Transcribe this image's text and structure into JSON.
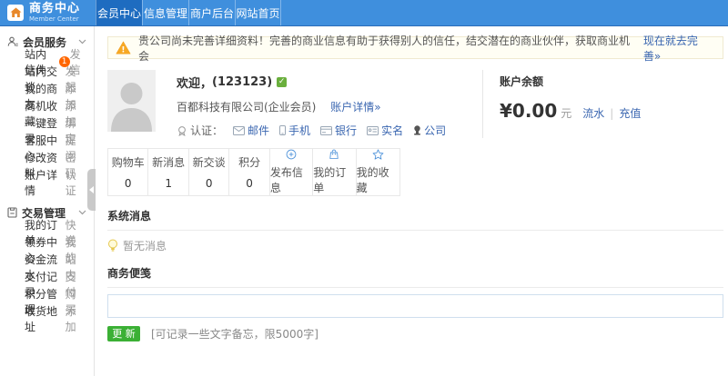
{
  "header": {
    "logo": {
      "title": "商务中心",
      "subtitle": "Member Center"
    },
    "tabs": [
      {
        "label": "会员中心",
        "active": true
      },
      {
        "label": "信息管理",
        "active": false
      },
      {
        "label": "商户后台",
        "active": false
      },
      {
        "label": "网站首页",
        "active": false
      }
    ]
  },
  "sidebar": {
    "sections": [
      {
        "title": "会员服务",
        "items": [
          {
            "label": "站内信件",
            "badge": "1",
            "action": "发信"
          },
          {
            "label": "站内交谈",
            "action": "发起"
          },
          {
            "label": "我的商友",
            "action": "添加"
          },
          {
            "label": "商机收藏",
            "action": "添加"
          },
          {
            "label": "一键登录",
            "action": "绑定"
          },
          {
            "label": "客服中心",
            "action": "提问"
          },
          {
            "label": "修改资料",
            "action": "密码"
          },
          {
            "label": "账户详情",
            "action": "认证"
          }
        ]
      },
      {
        "title": "交易管理",
        "items": [
          {
            "label": "我的订单",
            "action": "快递"
          },
          {
            "label": "领券中心",
            "action": "我的"
          },
          {
            "label": "资金流水",
            "action": "站内"
          },
          {
            "label": "支付记录",
            "action": "支付"
          },
          {
            "label": "积分管理",
            "action": "购买"
          },
          {
            "label": "收货地址",
            "action": "添加"
          }
        ]
      }
    ]
  },
  "main": {
    "notice": {
      "text": "贵公司尚未完善详细资料！完善的商业信息有助于获得别人的信任，结交潜在的商业伙伴，获取商业机会",
      "link": "现在就去完善»"
    },
    "profile": {
      "welcome": "欢迎，",
      "username": "(123123)",
      "company": "百都科技有限公司(企业会员)",
      "detail_link": "账户详情»",
      "auth_label": "认证：",
      "auth_links": [
        "邮件",
        "手机",
        "银行",
        "实名",
        "公司"
      ]
    },
    "balance": {
      "title": "账户余额",
      "amount": "¥0.00",
      "unit": "元",
      "link_flow": "流水",
      "link_recharge": "充值",
      "separator": "|"
    },
    "stats": [
      {
        "label": "购物车",
        "value": "0"
      },
      {
        "label": "新消息",
        "value": "1"
      },
      {
        "label": "新交谈",
        "value": "0"
      },
      {
        "label": "积分",
        "value": "0"
      }
    ],
    "shortcuts": [
      {
        "label": "发布信息",
        "icon": "plus-circle-icon"
      },
      {
        "label": "我的订单",
        "icon": "shopping-bag-icon"
      },
      {
        "label": "我的收藏",
        "icon": "star-icon"
      }
    ],
    "system_message": {
      "title": "系统消息",
      "empty_text": "暂无消息"
    },
    "memo": {
      "title": "商务便笺",
      "value": "",
      "button": "更 新",
      "hint": "[可记录一些文字备忘，限5000字]"
    }
  },
  "colors": {
    "header_blue": "#3f8fdd",
    "tab_active_blue": "#1e6cc0",
    "link_blue": "#3a66b0",
    "icon_blue": "#4a90d9",
    "button_green": "#3bb035",
    "badge_orange": "#ff6600",
    "warning_orange": "#f7a824"
  }
}
